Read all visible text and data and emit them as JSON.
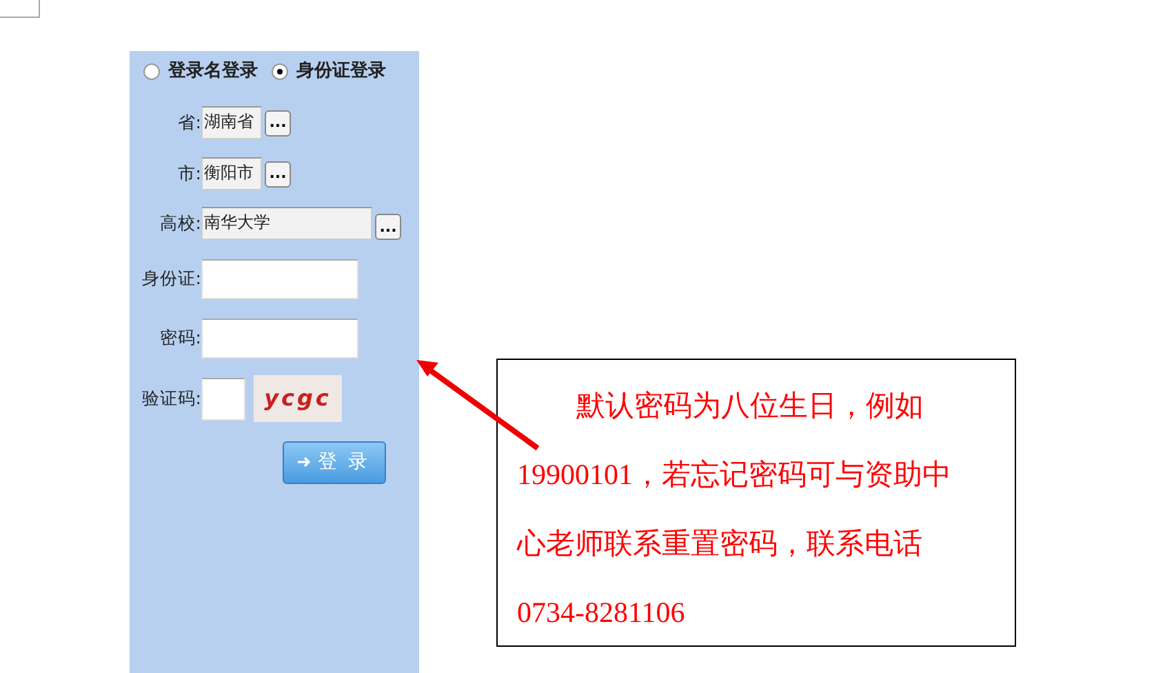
{
  "login_form": {
    "modes": [
      {
        "label": "登录名登录",
        "selected": false
      },
      {
        "label": "身份证登录",
        "selected": true
      }
    ],
    "fields": [
      {
        "kind": "picker",
        "label": "省:",
        "value": "湖南省",
        "button": "..."
      },
      {
        "kind": "picker",
        "label": "市:",
        "value": "衡阳市",
        "button": "..."
      },
      {
        "kind": "wide_picker",
        "label": "高校:",
        "value": "南华大学",
        "button": "..."
      },
      {
        "kind": "text",
        "label": "身份证:"
      },
      {
        "kind": "text",
        "label": "密码:"
      },
      {
        "kind": "captcha",
        "label": "验证码:",
        "captcha": "ycgc"
      }
    ],
    "submit": "登 录"
  },
  "note": {
    "lines": [
      "默认密码为八位生日，例如",
      "19900101，若忘记密码可与资助中",
      "心老师联系重置密码，联系电话",
      "0734-8281106"
    ]
  }
}
